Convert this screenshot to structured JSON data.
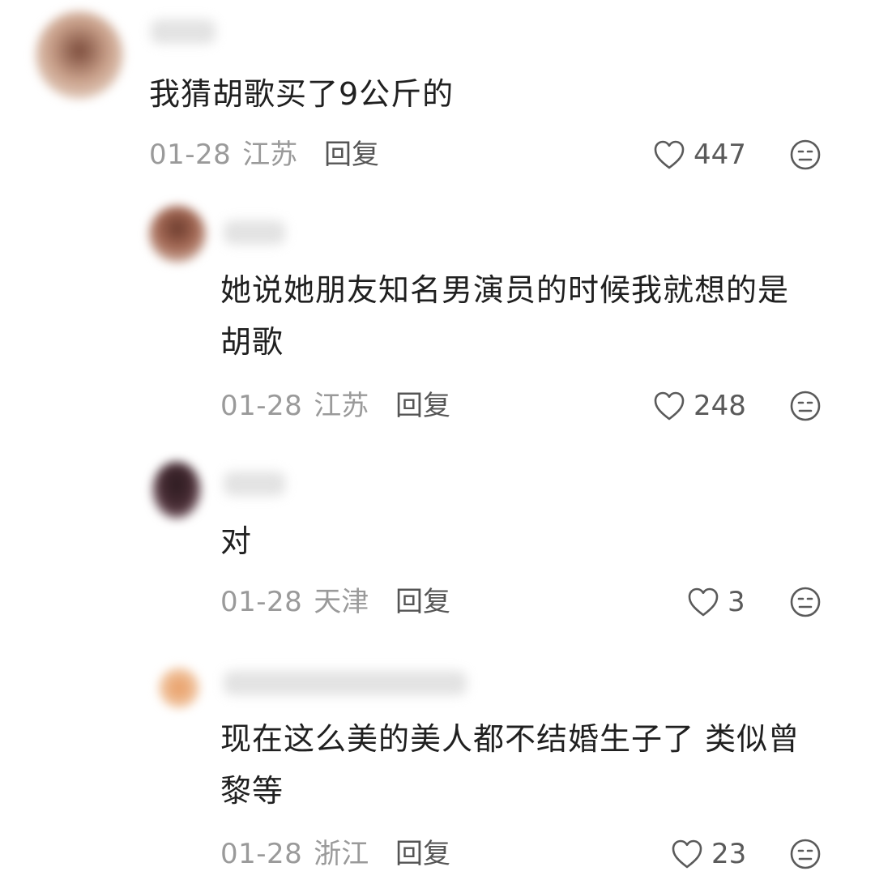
{
  "comments": [
    {
      "avatar_color": "#b98c78",
      "text": "我猜胡歌买了9公斤的",
      "date": "01-28",
      "location": "江苏",
      "reply_label": "回复",
      "likes": "447"
    },
    {
      "avatar_color": "#8a5a48",
      "text": "她说她朋友知名男演员的时候我就想的是\n胡歌",
      "date": "01-28",
      "location": "江苏",
      "reply_label": "回复",
      "likes": "248"
    },
    {
      "avatar_color": "#3a2a30",
      "text": "对",
      "date": "01-28",
      "location": "天津",
      "reply_label": "回复",
      "likes": "3"
    },
    {
      "avatar_color": "#e0a070",
      "text": "现在这么美的美人都不结婚生子了 类似曾\n黎等",
      "date": "01-28",
      "location": "浙江",
      "reply_label": "回复",
      "likes": "23"
    }
  ],
  "icons": {
    "like": "heart-outline-icon",
    "dislike": "neutral-face-icon"
  }
}
